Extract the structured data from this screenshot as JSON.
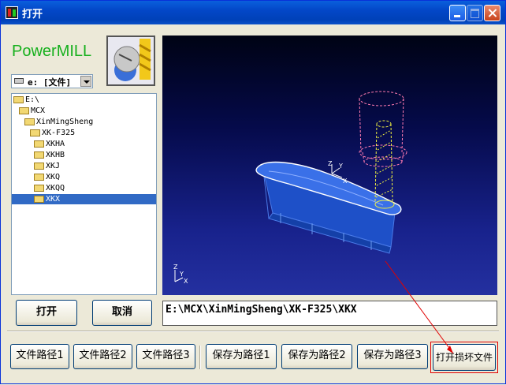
{
  "window": {
    "title": "打开"
  },
  "brand": {
    "logo_text": "PowerMILL"
  },
  "drive": {
    "selected": "e: [文件]"
  },
  "tree": {
    "nodes": [
      "E:\\",
      "MCX",
      "XinMingSheng",
      "XK-F325",
      "XKHA",
      "XKHB",
      "XKJ",
      "XKQ",
      "XKQQ",
      "XKX"
    ],
    "selected": "XKX"
  },
  "actions": {
    "open": "打开",
    "cancel": "取消"
  },
  "path": {
    "value": "E:\\MCX\\XinMingSheng\\XK-F325\\XKX"
  },
  "bottom_buttons": [
    "文件路径1",
    "文件路径2",
    "文件路径3",
    "保存为路径1",
    "保存为路径2",
    "保存为路径3",
    "打开损坏文件"
  ],
  "viewport": {
    "axis_x": "X",
    "axis_y": "Y",
    "axis_z": "Z"
  },
  "colors": {
    "accent_green": "#16b01d",
    "highlight_red": "#e00000",
    "selection": "#316ac5"
  }
}
